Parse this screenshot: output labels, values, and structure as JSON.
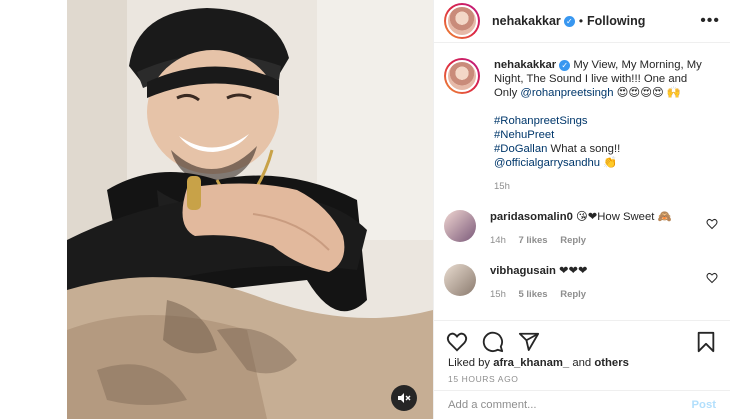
{
  "header": {
    "username": "nehakakkar",
    "separator": "•",
    "follow_status": "Following",
    "more_label": "•••"
  },
  "caption": {
    "username": "nehakakkar",
    "line1": "My View, My Morning, My Night, The Sound I live with!!! One and Only ",
    "mention": "@rohanpreetsingh",
    "emojis": " 😍😍😍😍 🙌",
    "hashtag1": "#RohanpreetSings",
    "hashtag2": "#NehuPreet",
    "hashtag3": "#DoGallan",
    "tail": " What a song!!",
    "mention2": "@officialgarrysandhu",
    "emoji2": " 👏",
    "time": "15h"
  },
  "comments": [
    {
      "username": "paridasomalin0",
      "text": " 😘❤How Sweet 🙈",
      "time": "14h",
      "likes": "7 likes",
      "reply": "Reply"
    },
    {
      "username": "vibhagusain",
      "text": " ❤❤❤",
      "time": "15h",
      "likes": "5 likes",
      "reply": "Reply"
    }
  ],
  "likes": {
    "prefix": "Liked by ",
    "user": "afra_khanam_",
    "mid": " and ",
    "others": "others"
  },
  "date": "15 HOURS AGO",
  "add_comment": {
    "placeholder": "Add a comment...",
    "post_label": "Post"
  },
  "icons": {
    "like": "heart-icon",
    "comment": "comment-icon",
    "share": "share-icon",
    "save": "bookmark-icon",
    "mute": "speaker-muted-icon"
  },
  "colors": {
    "link": "#00376b",
    "verified": "#3897f0",
    "post_button": "#b2dffc",
    "muted_text": "#8e8e8e"
  }
}
